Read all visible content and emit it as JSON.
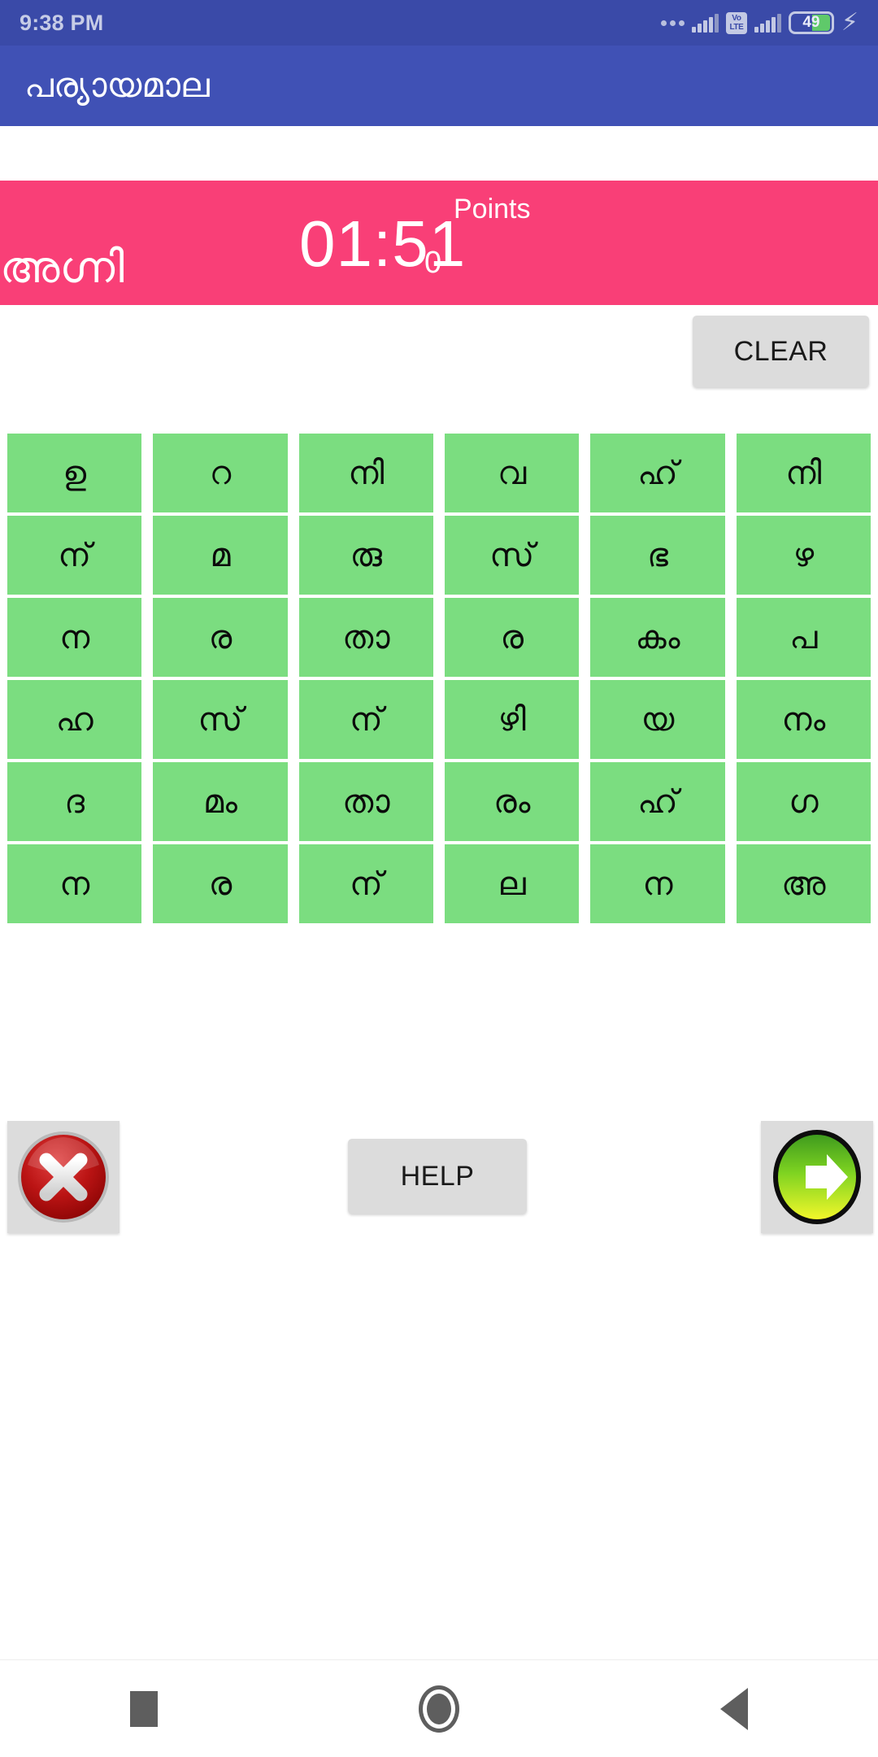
{
  "statusbar": {
    "clock": "9:38 PM",
    "volte_top": "Vo",
    "volte_bottom": "LTE",
    "battery_level": "49"
  },
  "appbar": {
    "title": "പര്യായമാല"
  },
  "infoband": {
    "clue_word": "അഗ്നി",
    "timer": "01:51",
    "points_value": "0",
    "points_label": "Points",
    "background_color": "#f93f77"
  },
  "toolbar": {
    "clear_label": "CLEAR"
  },
  "grid": {
    "columns": 6,
    "rows": 6,
    "tile_color": "#7bdd80",
    "tiles": [
      "ഉ",
      "റ",
      "നി",
      "വ",
      "ഹ്",
      "നി",
      "ന്",
      "മ",
      "രു",
      "സ്",
      "ഭ",
      "ഴ",
      "ന",
      "ര",
      "താ",
      "ര",
      "കം",
      "പ",
      "ഹ",
      "സ്",
      "ന്",
      "ഴി",
      "യ",
      "നം",
      "ദ",
      "മം",
      "താ",
      "രം",
      "ഹ്",
      "ഗ",
      "ന",
      "ര",
      "ന്",
      "ല",
      "ന",
      "അ"
    ]
  },
  "actions": {
    "cancel_icon": "red-cross-circle-icon",
    "help_label": "HELP",
    "next_icon": "green-arrow-right-circle-icon"
  },
  "navbar": {
    "recents_icon": "square-icon",
    "home_icon": "circle-icon",
    "back_icon": "triangle-left-icon"
  }
}
